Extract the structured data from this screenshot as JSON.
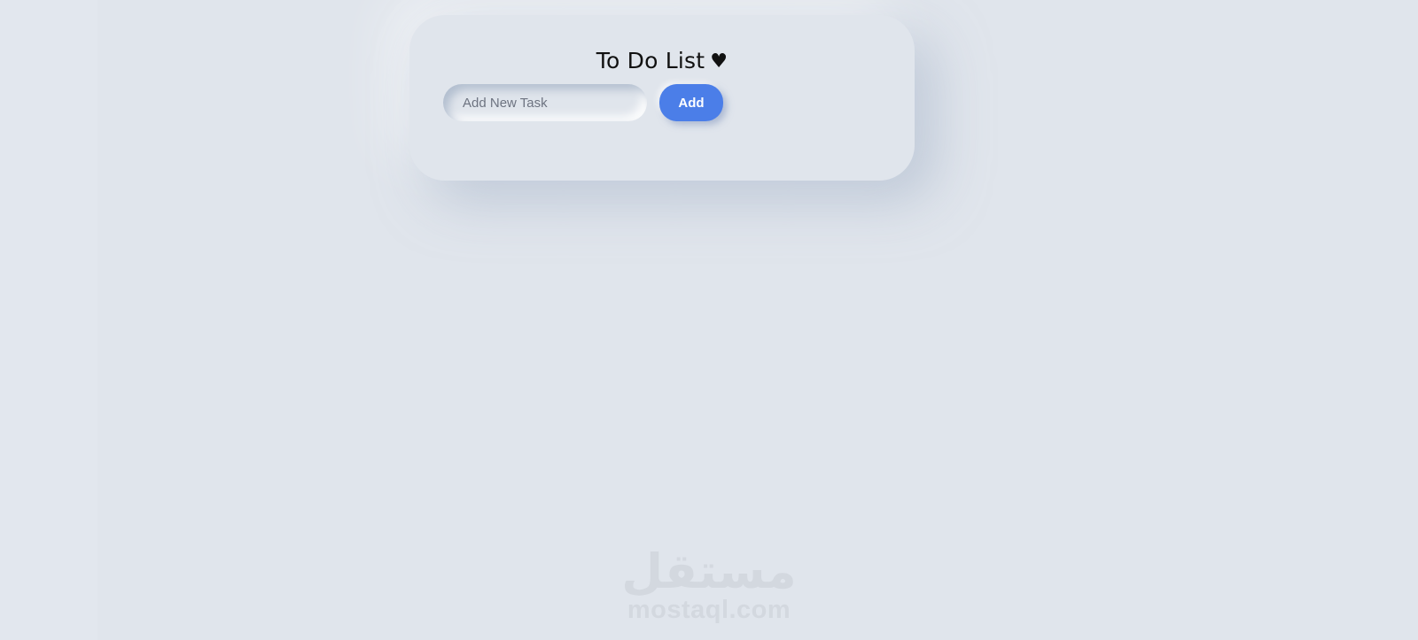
{
  "app": {
    "title": "To Do List",
    "title_icon": "heart-icon",
    "title_icon_glyph": "♥"
  },
  "task_form": {
    "input_value": "",
    "input_placeholder": "Add New Task",
    "add_label": "Add"
  },
  "tasks": [],
  "watermark": {
    "arabic": "مستقل",
    "latin": "mostaql.com"
  },
  "colors": {
    "background": "#e0e5ec",
    "accent": "#4b7ee8",
    "title_text": "#111111",
    "watermark": "#d3d8df"
  }
}
